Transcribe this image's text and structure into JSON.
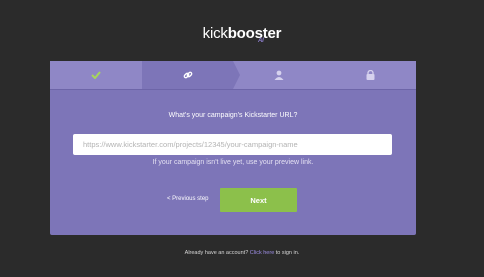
{
  "logo": {
    "part1": "kick",
    "part2": "booster",
    "badge": "AI"
  },
  "steps": [
    {
      "name": "complete",
      "icon": "checkmark-icon",
      "color": "#a6d65a"
    },
    {
      "name": "url",
      "icon": "link-icon",
      "color": "#ffffff"
    },
    {
      "name": "account",
      "icon": "user-icon",
      "color": "#d6d2ee"
    },
    {
      "name": "secure",
      "icon": "lock-icon",
      "color": "#d6d2ee"
    }
  ],
  "form": {
    "question": "What's your campaign's Kickstarter URL?",
    "url_placeholder": "https://www.kickstarter.com/projects/12345/your-campaign-name",
    "url_value": "",
    "hint": "If your campaign isn't live yet, use your preview link.",
    "prev_label": "< Previous step",
    "next_label": "Next"
  },
  "footer": {
    "text": "Already have an account? ",
    "link": "Click here",
    "suffix": " to sign in."
  },
  "colors": {
    "background": "#2b2b2b",
    "card": "#7d75b8",
    "next_button": "#8cc04b",
    "link": "#9e8fe6"
  }
}
